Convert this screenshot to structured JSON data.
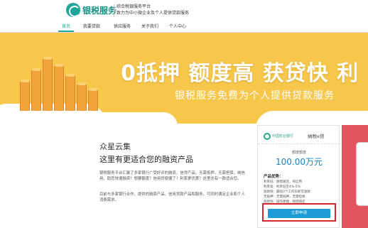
{
  "header": {
    "logo_text": "银税服务",
    "slogan_line1": "综合税银服务平台",
    "slogan_line2": "致力为中小微企业及个人提供贷款服务"
  },
  "nav": {
    "items": [
      {
        "label": "首页",
        "active": true
      },
      {
        "label": "我要贷款",
        "active": false
      },
      {
        "label": "供应服务",
        "active": false
      },
      {
        "label": "关于我们",
        "active": false
      },
      {
        "label": "个人中心",
        "active": false
      }
    ]
  },
  "banner": {
    "headline": "0抵押 额度高 获贷快 利",
    "subline": "银税服务免费为个人提供贷款服务",
    "accent_color": "#f6c74b"
  },
  "intro": {
    "title": "众星云集",
    "subtitle": "这里有更适合您的融资产品",
    "paragraph1": "银税服务平台汇聚了多家银行广受好评的融资、信贷产品，无需抵押，无需担保，纯信用，助您快速融资！想要额度？信用贷便捷了！利率更优惠？这里总有一款适合您。",
    "paragraph2": "目前与多家银行合作，提供的融资产品、信用贷款产品和服务，可同时满足企业和个人消费需求。"
  },
  "card": {
    "bank_name": "中国农业银行",
    "product_name": "纳税e贷",
    "limit_label": "额度额度",
    "limit_value": "100.00万元",
    "advantages_title": "产品优势：",
    "advantages": [
      "利率低：随借随还，纯信用",
      "利率高：利率低至4%-5%",
      "放款快：最短3个工作日即可放款",
      "无抵押：无需抵押，无需担保",
      "放款快：操作便捷，随借随还"
    ],
    "apply_label": "立即申请",
    "apply_color": "#1e9ad6",
    "highlight_color": "#d9262b"
  }
}
